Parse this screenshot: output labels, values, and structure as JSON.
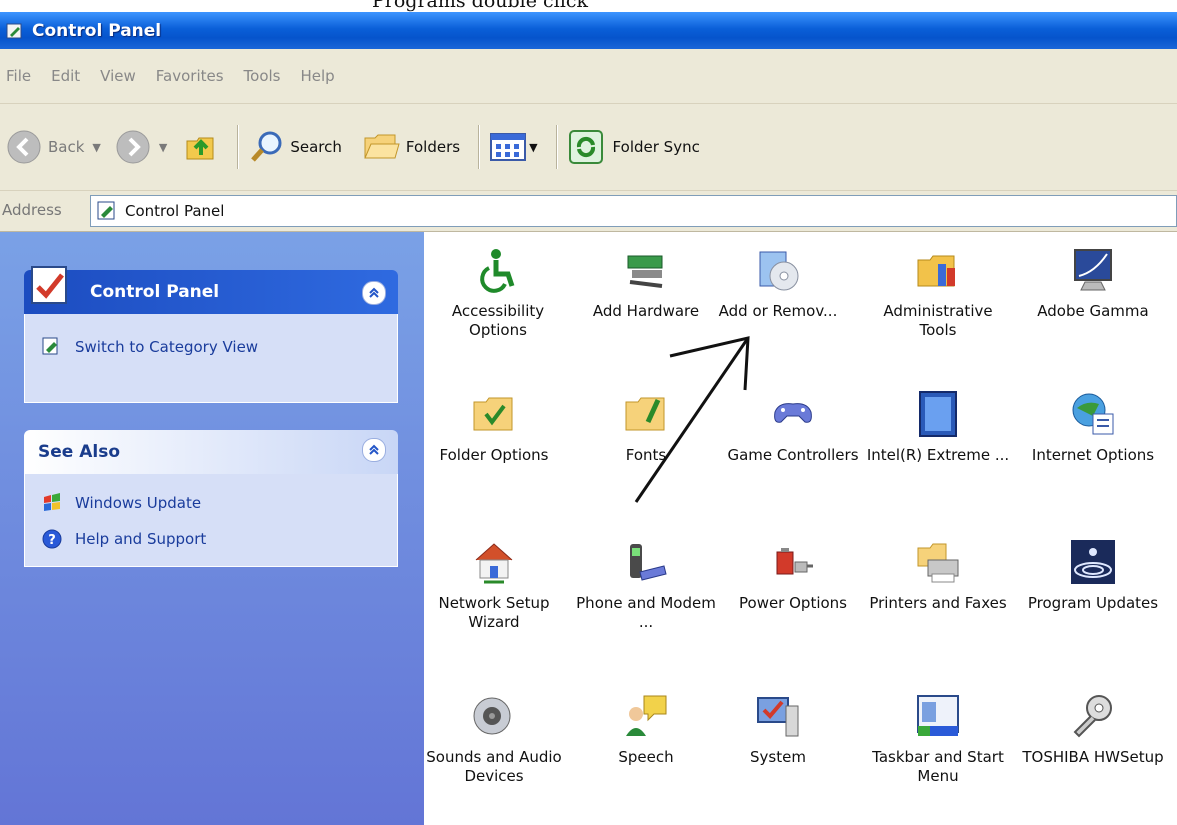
{
  "caption": "Programs double click",
  "window": {
    "title": "Control Panel"
  },
  "menu": [
    "File",
    "Edit",
    "View",
    "Favorites",
    "Tools",
    "Help"
  ],
  "toolbar": {
    "back": "Back",
    "search": "Search",
    "folders": "Folders",
    "folder_sync": "Folder Sync"
  },
  "address": {
    "label": "Address",
    "value": "Control Panel"
  },
  "sidebar": {
    "control_panel": {
      "title": "Control Panel",
      "link": "Switch to Category View"
    },
    "see_also": {
      "title": "See Also",
      "links": [
        "Windows Update",
        "Help and Support"
      ]
    }
  },
  "items": [
    {
      "label": "Accessibility Options",
      "icon": "accessibility-icon"
    },
    {
      "label": "Add Hardware",
      "icon": "add-hardware-icon"
    },
    {
      "label": "Add or Remov...",
      "icon": "add-remove-programs-icon"
    },
    {
      "label": "Administrative Tools",
      "icon": "administrative-tools-icon"
    },
    {
      "label": "Adobe Gamma",
      "icon": "adobe-gamma-icon"
    },
    {
      "label": "Folder Options",
      "icon": "folder-options-icon"
    },
    {
      "label": "Fonts",
      "icon": "fonts-icon"
    },
    {
      "label": "Game Controllers",
      "icon": "game-controllers-icon"
    },
    {
      "label": "Intel(R) Extreme ...",
      "icon": "intel-graphics-icon"
    },
    {
      "label": "Internet Options",
      "icon": "internet-options-icon"
    },
    {
      "label": "Network Setup Wizard",
      "icon": "network-setup-icon"
    },
    {
      "label": "Phone and Modem ...",
      "icon": "phone-modem-icon"
    },
    {
      "label": "Power Options",
      "icon": "power-options-icon"
    },
    {
      "label": "Printers and Faxes",
      "icon": "printers-icon"
    },
    {
      "label": "Program Updates",
      "icon": "program-updates-icon"
    },
    {
      "label": "Sounds and Audio Devices",
      "icon": "sounds-icon"
    },
    {
      "label": "Speech",
      "icon": "speech-icon"
    },
    {
      "label": "System",
      "icon": "system-icon"
    },
    {
      "label": "Taskbar and Start Menu",
      "icon": "taskbar-icon"
    },
    {
      "label": "TOSHIBA HWSetup",
      "icon": "toshiba-hwsetup-icon"
    }
  ],
  "colors": {
    "title_bar": "#0a5fd8",
    "sidebar": "#6e8ddd",
    "panel_header": "#2456c8",
    "link": "#1a3c9c"
  }
}
